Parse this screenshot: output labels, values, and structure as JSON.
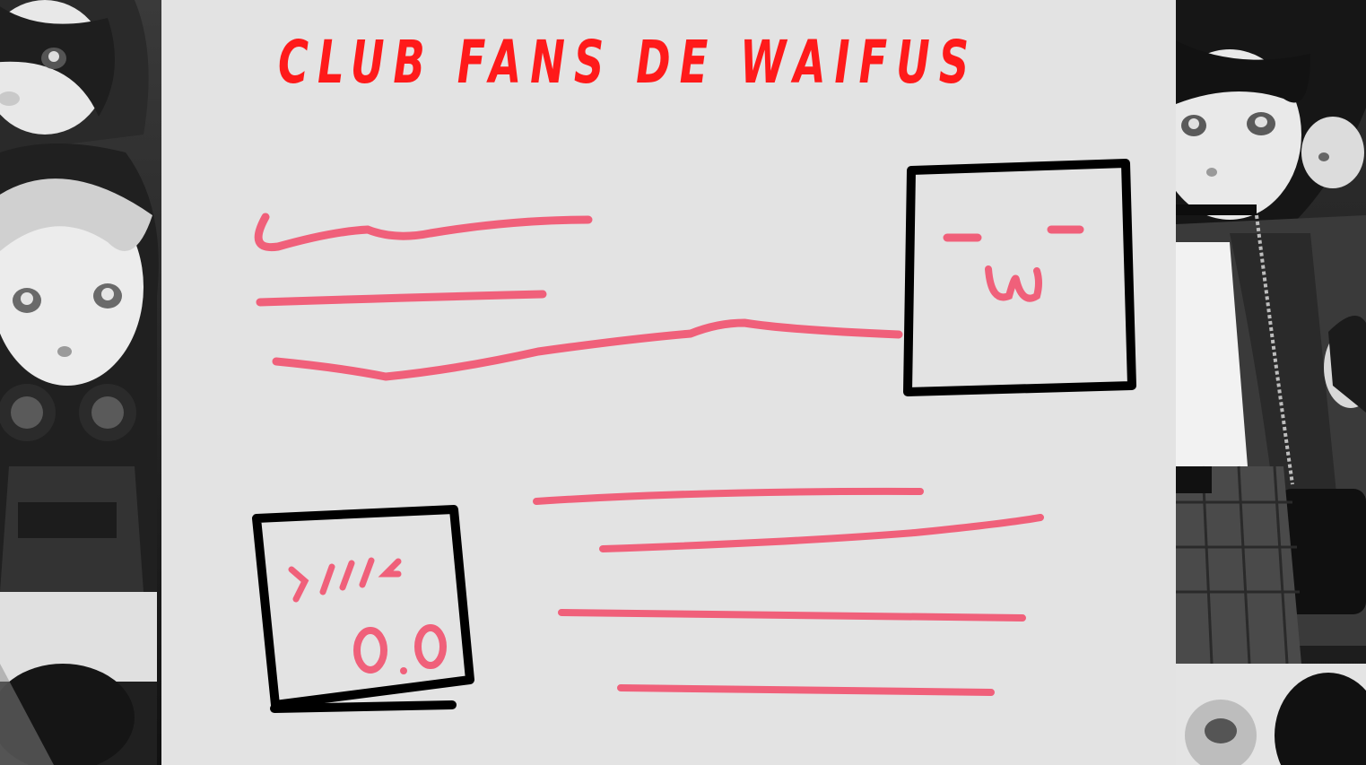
{
  "title": "CLUB FANS DE WAIFUS",
  "face_upper": {
    "eyes": "- -",
    "mouth": "w"
  },
  "face_lower": {
    "blush": ">///<",
    "eyes": "0.0"
  },
  "colors": {
    "title": "#ff1a1a",
    "scribble": "#f0607a",
    "outline": "#000000",
    "canvas": "#e3e3e3"
  },
  "left_panel": {
    "description_icon": "anime-illustration-grayscale"
  },
  "right_panel": {
    "description_icon": "anime-illustration-grayscale"
  }
}
